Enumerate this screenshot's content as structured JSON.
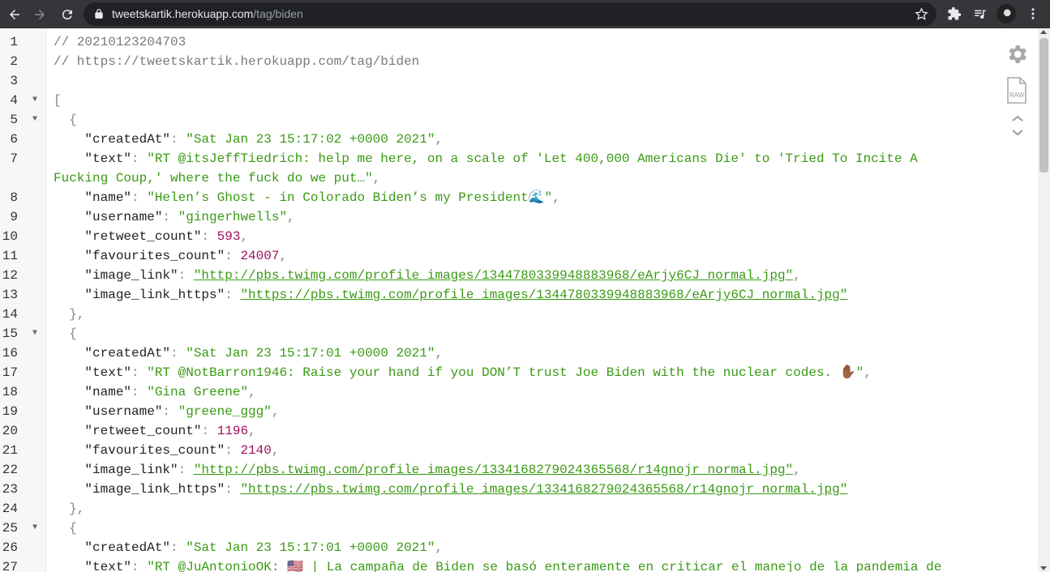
{
  "browser": {
    "url_host": "tweetskartik.herokuapp.com",
    "url_path": "/tag/biden",
    "icons": [
      "back-icon",
      "forward-icon",
      "reload-icon",
      "lock-icon",
      "star-icon",
      "extensions-icon",
      "media-control-icon",
      "profile-avatar",
      "more-icon"
    ]
  },
  "viewer": {
    "tools": [
      "gear-icon",
      "raw-icon",
      "collapse-up-icon",
      "expand-down-icon"
    ],
    "raw_label": "RAW",
    "lines": [
      {
        "n": "1",
        "fold": "",
        "segs": [
          {
            "t": "// 20210123204703",
            "c": "comment"
          }
        ]
      },
      {
        "n": "2",
        "fold": "",
        "segs": [
          {
            "t": "// https://tweetskartik.herokuapp.com/tag/biden",
            "c": "comment"
          }
        ]
      },
      {
        "n": "3",
        "fold": "",
        "segs": []
      },
      {
        "n": "4",
        "fold": "▼",
        "segs": [
          {
            "t": "[",
            "c": "punc"
          }
        ]
      },
      {
        "n": "5",
        "fold": "▼",
        "segs": [
          {
            "t": "  {",
            "c": "punc"
          }
        ]
      },
      {
        "n": "6",
        "fold": "",
        "segs": [
          {
            "t": "    \"createdAt\"",
            "c": "key"
          },
          {
            "t": ": ",
            "c": "punc"
          },
          {
            "t": "\"Sat Jan 23 15:17:02 +0000 2021\"",
            "c": "str"
          },
          {
            "t": ",",
            "c": "punc"
          }
        ]
      },
      {
        "n": "7",
        "fold": "",
        "wrap": true,
        "segs": [
          {
            "t": "    \"text\"",
            "c": "key"
          },
          {
            "t": ": ",
            "c": "punc"
          },
          {
            "t": "\"RT @itsJeffTiedrich: help me here, on a scale of 'Let 400,000 Americans Die' to 'Tried To Incite A\nFucking Coup,' where the fuck do we put…\"",
            "c": "str"
          },
          {
            "t": ",",
            "c": "punc"
          }
        ]
      },
      {
        "n": "8",
        "fold": "",
        "segs": [
          {
            "t": "    \"name\"",
            "c": "key"
          },
          {
            "t": ": ",
            "c": "punc"
          },
          {
            "t": "\"Helen’s Ghost - in Colorado Biden’s my President🌊\"",
            "c": "str"
          },
          {
            "t": ",",
            "c": "punc"
          }
        ]
      },
      {
        "n": "9",
        "fold": "",
        "segs": [
          {
            "t": "    \"username\"",
            "c": "key"
          },
          {
            "t": ": ",
            "c": "punc"
          },
          {
            "t": "\"gingerhwells\"",
            "c": "str"
          },
          {
            "t": ",",
            "c": "punc"
          }
        ]
      },
      {
        "n": "10",
        "fold": "",
        "segs": [
          {
            "t": "    \"retweet_count\"",
            "c": "key"
          },
          {
            "t": ": ",
            "c": "punc"
          },
          {
            "t": "593",
            "c": "num"
          },
          {
            "t": ",",
            "c": "punc"
          }
        ]
      },
      {
        "n": "11",
        "fold": "",
        "segs": [
          {
            "t": "    \"favourites_count\"",
            "c": "key"
          },
          {
            "t": ": ",
            "c": "punc"
          },
          {
            "t": "24007",
            "c": "num"
          },
          {
            "t": ",",
            "c": "punc"
          }
        ]
      },
      {
        "n": "12",
        "fold": "",
        "segs": [
          {
            "t": "    \"image_link\"",
            "c": "key"
          },
          {
            "t": ": ",
            "c": "punc"
          },
          {
            "t": "\"http://pbs.twimg.com/profile_images/1344780339948883968/eArjy6CJ_normal.jpg\"",
            "c": "link"
          },
          {
            "t": ",",
            "c": "punc"
          }
        ]
      },
      {
        "n": "13",
        "fold": "",
        "segs": [
          {
            "t": "    \"image_link_https\"",
            "c": "key"
          },
          {
            "t": ": ",
            "c": "punc"
          },
          {
            "t": "\"https://pbs.twimg.com/profile_images/1344780339948883968/eArjy6CJ_normal.jpg\"",
            "c": "link"
          }
        ]
      },
      {
        "n": "14",
        "fold": "",
        "segs": [
          {
            "t": "  },",
            "c": "punc"
          }
        ]
      },
      {
        "n": "15",
        "fold": "▼",
        "segs": [
          {
            "t": "  {",
            "c": "punc"
          }
        ]
      },
      {
        "n": "16",
        "fold": "",
        "segs": [
          {
            "t": "    \"createdAt\"",
            "c": "key"
          },
          {
            "t": ": ",
            "c": "punc"
          },
          {
            "t": "\"Sat Jan 23 15:17:01 +0000 2021\"",
            "c": "str"
          },
          {
            "t": ",",
            "c": "punc"
          }
        ]
      },
      {
        "n": "17",
        "fold": "",
        "segs": [
          {
            "t": "    \"text\"",
            "c": "key"
          },
          {
            "t": ": ",
            "c": "punc"
          },
          {
            "t": "\"RT @NotBarron1946: Raise your hand if you DON’T trust Joe Biden with the nuclear codes. ✋🏾\"",
            "c": "str"
          },
          {
            "t": ",",
            "c": "punc"
          }
        ]
      },
      {
        "n": "18",
        "fold": "",
        "segs": [
          {
            "t": "    \"name\"",
            "c": "key"
          },
          {
            "t": ": ",
            "c": "punc"
          },
          {
            "t": "\"Gina Greene\"",
            "c": "str"
          },
          {
            "t": ",",
            "c": "punc"
          }
        ]
      },
      {
        "n": "19",
        "fold": "",
        "segs": [
          {
            "t": "    \"username\"",
            "c": "key"
          },
          {
            "t": ": ",
            "c": "punc"
          },
          {
            "t": "\"greene_ggg\"",
            "c": "str"
          },
          {
            "t": ",",
            "c": "punc"
          }
        ]
      },
      {
        "n": "20",
        "fold": "",
        "segs": [
          {
            "t": "    \"retweet_count\"",
            "c": "key"
          },
          {
            "t": ": ",
            "c": "punc"
          },
          {
            "t": "1196",
            "c": "num"
          },
          {
            "t": ",",
            "c": "punc"
          }
        ]
      },
      {
        "n": "21",
        "fold": "",
        "segs": [
          {
            "t": "    \"favourites_count\"",
            "c": "key"
          },
          {
            "t": ": ",
            "c": "punc"
          },
          {
            "t": "2140",
            "c": "num"
          },
          {
            "t": ",",
            "c": "punc"
          }
        ]
      },
      {
        "n": "22",
        "fold": "",
        "segs": [
          {
            "t": "    \"image_link\"",
            "c": "key"
          },
          {
            "t": ": ",
            "c": "punc"
          },
          {
            "t": "\"http://pbs.twimg.com/profile_images/1334168279024365568/r14gnojr_normal.jpg\"",
            "c": "link"
          },
          {
            "t": ",",
            "c": "punc"
          }
        ]
      },
      {
        "n": "23",
        "fold": "",
        "segs": [
          {
            "t": "    \"image_link_https\"",
            "c": "key"
          },
          {
            "t": ": ",
            "c": "punc"
          },
          {
            "t": "\"https://pbs.twimg.com/profile_images/1334168279024365568/r14gnojr_normal.jpg\"",
            "c": "link"
          }
        ]
      },
      {
        "n": "24",
        "fold": "",
        "segs": [
          {
            "t": "  },",
            "c": "punc"
          }
        ]
      },
      {
        "n": "25",
        "fold": "▼",
        "segs": [
          {
            "t": "  {",
            "c": "punc"
          }
        ]
      },
      {
        "n": "26",
        "fold": "",
        "segs": [
          {
            "t": "    \"createdAt\"",
            "c": "key"
          },
          {
            "t": ": ",
            "c": "punc"
          },
          {
            "t": "\"Sat Jan 23 15:17:01 +0000 2021\"",
            "c": "str"
          },
          {
            "t": ",",
            "c": "punc"
          }
        ]
      },
      {
        "n": "27",
        "fold": "",
        "segs": [
          {
            "t": "    \"text\"",
            "c": "key"
          },
          {
            "t": ": ",
            "c": "punc"
          },
          {
            "t": "\"RT @JuAntonioOK: 🇺🇸 | La campaña de Biden se basó enteramente en criticar el manejo de la pandemia de",
            "c": "str"
          }
        ]
      }
    ]
  }
}
